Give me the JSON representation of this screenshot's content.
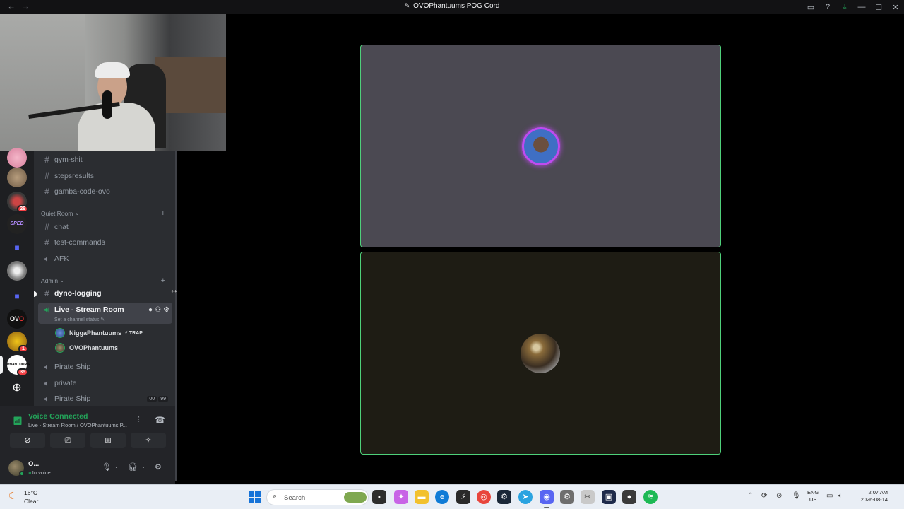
{
  "window": {
    "title": "OVOPhantuums POG Cord",
    "back_icon": "←",
    "forward_icon": "→"
  },
  "channels": [
    {
      "name": "gym-shit",
      "type": "text"
    },
    {
      "name": "stepsresults",
      "type": "text"
    },
    {
      "name": "gamba-code-ovo",
      "type": "text"
    }
  ],
  "categories": {
    "quiet_room": {
      "label": "Quiet Room",
      "channels": [
        {
          "name": "chat",
          "type": "text"
        },
        {
          "name": "test-commands",
          "type": "text"
        },
        {
          "name": "AFK",
          "type": "voice"
        }
      ]
    },
    "admin": {
      "label": "Admin",
      "channels": [
        {
          "name": "dyno-logging",
          "type": "text"
        }
      ]
    }
  },
  "active_voice_channel": {
    "name": "Live - Stream Room",
    "status_placeholder": "Set a channel status",
    "users": [
      {
        "name": "NiggaPhantuums",
        "tag": "TRAP"
      },
      {
        "name": "OVOPhantuums",
        "tag": ""
      }
    ]
  },
  "more_voice_channels": [
    {
      "name": "Pirate Ship"
    },
    {
      "name": "private"
    },
    {
      "name": "Pirate Ship",
      "counts": [
        "00",
        "99"
      ]
    }
  ],
  "server_badges": [
    "26",
    "1",
    "35"
  ],
  "voice_connection": {
    "status": "Voice Connected",
    "channel_path": "Live - Stream Room / OVOPhantuums P..."
  },
  "user_panel": {
    "name": "O...",
    "status": "In voice"
  },
  "taskbar": {
    "temperature": "16°C",
    "weather": "Clear",
    "search_placeholder": "Search",
    "lang_1": "ENG",
    "lang_2": "US",
    "time": "2:07 AM",
    "date": "2026-08-14"
  },
  "colors": {
    "speaking_border": "#4ed07a",
    "voice_green": "#23a55a",
    "discord_blurple": "#5865f2",
    "avatar_ring": "#c04bf0"
  }
}
